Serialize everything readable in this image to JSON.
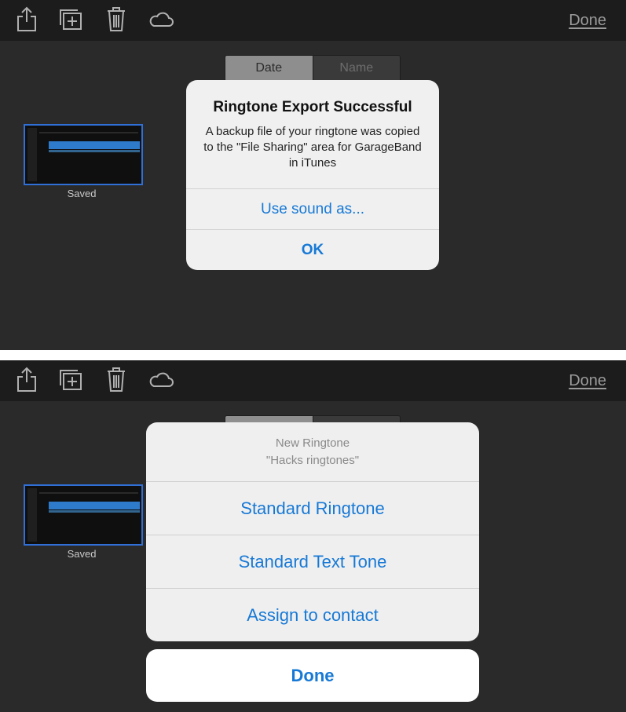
{
  "screen_top": {
    "toolbar": {
      "icons": [
        "share-icon",
        "add-icon",
        "trash-icon",
        "cloud-icon"
      ],
      "done_label": "Done"
    },
    "sort": {
      "tabs": [
        "Date",
        "Name"
      ],
      "selected": "Date"
    },
    "file": {
      "label": "Saved"
    },
    "alert": {
      "title": "Ringtone Export Successful",
      "message": "A backup file of your ringtone was copied to the \"File Sharing\" area for GarageBand in iTunes",
      "buttons": [
        "Use sound as...",
        "OK"
      ]
    }
  },
  "screen_bottom": {
    "toolbar": {
      "icons": [
        "share-icon",
        "add-icon",
        "trash-icon",
        "cloud-icon"
      ],
      "done_label": "Done"
    },
    "file": {
      "label": "Saved"
    },
    "action_sheet": {
      "title": "New Ringtone",
      "subtitle": "\"Hacks ringtones\"",
      "options": [
        "Standard Ringtone",
        "Standard Text Tone",
        "Assign to contact"
      ],
      "cancel_label": "Done"
    }
  },
  "colors": {
    "accent": "#1779d6",
    "background": "#2a2a2a",
    "toolbar": "#1c1c1c",
    "selection": "#2f6fd6"
  }
}
